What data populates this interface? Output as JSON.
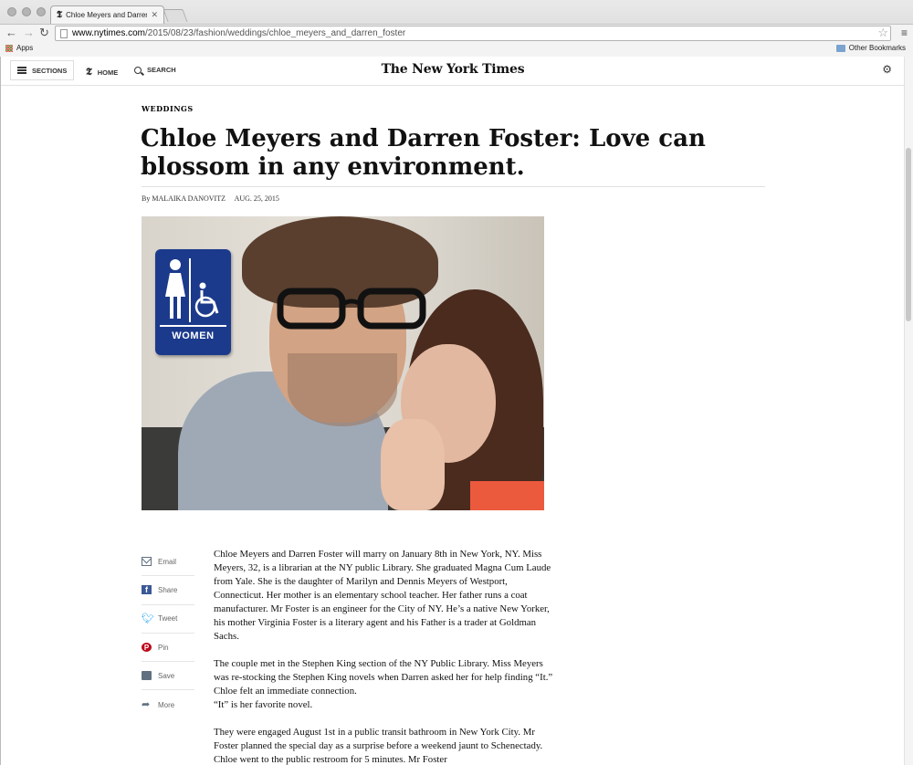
{
  "browser": {
    "tab_title": "Chloe Meyers and Darren Fo",
    "url_host": "www.nytimes.com",
    "url_path": "/2015/08/23/fashion/weddings/chloe_meyers_and_darren_foster",
    "bookmarks_apps": "Apps",
    "bookmarks_other": "Other Bookmarks"
  },
  "nav": {
    "sections": "SECTIONS",
    "home": "HOME",
    "search": "SEARCH",
    "masthead": "The New York Times"
  },
  "article": {
    "kicker": "WEDDINGS",
    "headline": "Chloe Meyers and Darren Foster: Love can blossom in any environment.",
    "byline": "By MALAIKA DANOVITZ",
    "date": "AUG. 25, 2015",
    "photo_sign_label": "WOMEN",
    "paragraphs": [
      "Chloe Meyers and Darren Foster will marry on January 8th in New York, NY. Miss Meyers, 32, is a librarian at the NY public Library. She graduated Magna Cum Laude from Yale. She is the daughter of Marilyn and Dennis Meyers of Westport, Connecticut. Her mother is an elementary school teacher. Her father runs a coat manufacturer. Mr Foster is an engineer for the City of NY. He’s a native New Yorker, his mother Virginia Foster is a literary agent and his Father is a trader at Goldman Sachs.",
      "The couple met in the Stephen King section of the NY Public Library. Miss Meyers was re-stocking the Stephen King novels when Darren asked her for help finding “It.” Chloe felt an immediate connection.",
      "“It” is her favorite novel.",
      "They were engaged August 1st in a public transit bathroom in New York City. Mr Foster planned the special day as a surprise before a weekend jaunt to Schenectady. Chloe went to the public restroom for 5 minutes. Mr Foster"
    ]
  },
  "share": [
    {
      "label": "Email",
      "icon": "email-icon"
    },
    {
      "label": "Share",
      "icon": "facebook-icon"
    },
    {
      "label": "Tweet",
      "icon": "twitter-icon"
    },
    {
      "label": "Pin",
      "icon": "pinterest-icon"
    },
    {
      "label": "Save",
      "icon": "save-icon"
    },
    {
      "label": "More",
      "icon": "more-arrow-icon"
    }
  ]
}
